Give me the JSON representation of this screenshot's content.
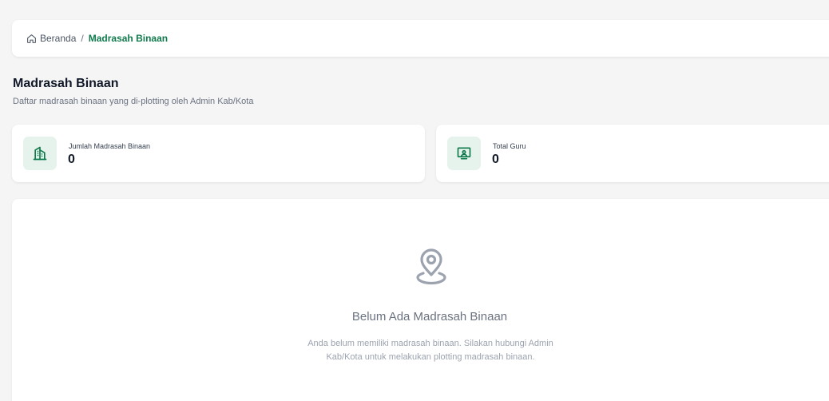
{
  "breadcrumb": {
    "home_label": "Beranda",
    "separator": "/",
    "current_label": "Madrasah Binaan",
    "home_icon": "home-icon"
  },
  "header": {
    "title": "Madrasah Binaan",
    "subtitle": "Daftar madrasah binaan yang di-plotting oleh Admin Kab/Kota"
  },
  "stats": [
    {
      "label": "Jumlah Madrasah Binaan",
      "value": "0",
      "icon": "building-icon"
    },
    {
      "label": "Total Guru",
      "value": "0",
      "icon": "teacher-board-icon"
    }
  ],
  "empty_state": {
    "icon": "map-pin-icon",
    "title": "Belum Ada Madrasah Binaan",
    "description": "Anda belum memiliki madrasah binaan. Silakan hubungi Admin Kab/Kota untuk melakukan plotting madrasah binaan."
  },
  "colors": {
    "accent": "#0f7a4c",
    "icon_bg": "#e5f3ec",
    "page_bg": "#f5f5f6"
  }
}
